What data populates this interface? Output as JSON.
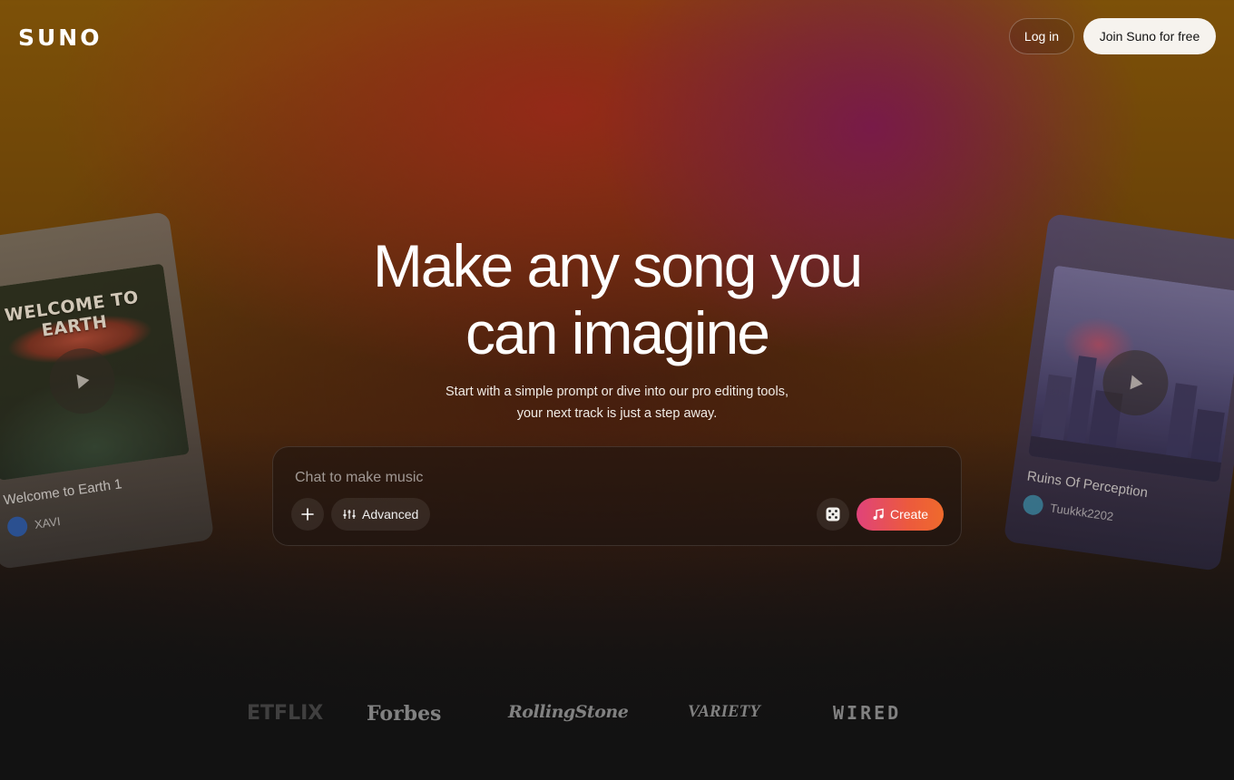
{
  "brand": {
    "logo": "SUNO"
  },
  "nav": {
    "login_label": "Log in",
    "join_label": "Join Suno for free"
  },
  "hero": {
    "headline_line1": "Make any song you",
    "headline_line2": "can imagine",
    "subtitle": "Start with a simple prompt or dive into our pro editing tools, your next track is just a step away."
  },
  "composer": {
    "placeholder": "Chat to make music",
    "add_icon": "plus-icon",
    "advanced_label": "Advanced",
    "advanced_icon": "sliders-icon",
    "random_icon": "dice-icon",
    "create_label": "Create",
    "create_icon": "music-note-icon",
    "create_gradient": [
      "#e0437a",
      "#ef6a2c"
    ]
  },
  "cards": [
    {
      "art_text": "WELCOME TO EARTH",
      "song_title": "Welcome to Earth 1",
      "artist": "XAVI"
    },
    {
      "art_text": "",
      "song_title": "Ruins Of Perception",
      "artist": "Tuukkk2202"
    }
  ],
  "press": [
    "ETFLIX",
    "Forbes",
    "RollingStone",
    "VARIETY",
    "WIRED"
  ]
}
